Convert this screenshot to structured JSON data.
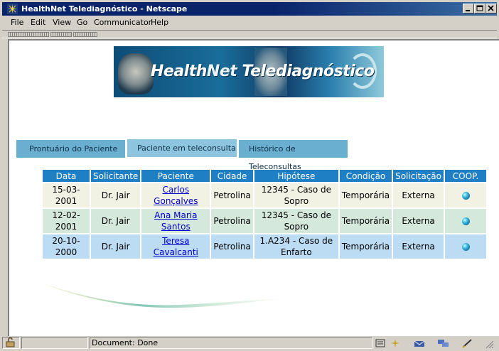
{
  "window": {
    "title": "HealthNet Telediagnóstico - Netscape",
    "controls": [
      "minimize",
      "maximize",
      "close"
    ]
  },
  "menubar": {
    "items": [
      {
        "label": "File"
      },
      {
        "label": "Edit"
      },
      {
        "label": "View"
      },
      {
        "label": "Go"
      },
      {
        "label": "Communicator"
      },
      {
        "label": "Help"
      }
    ]
  },
  "banner": {
    "brand_part1": "Health",
    "brand_part2": "Net",
    "brand_part3": " Telediagnóstico"
  },
  "tabs": [
    {
      "label": "Prontuário do Paciente",
      "active": false
    },
    {
      "label": "Paciente em teleconsulta",
      "active": true
    },
    {
      "label": "Histórico de Teleconsultas",
      "active": false
    }
  ],
  "table": {
    "headers": [
      "Data",
      "Solicitante",
      "Paciente",
      "Cidade",
      "Hipótese",
      "Condição",
      "Solicitação",
      "COOP."
    ],
    "rows": [
      {
        "data": "15-03-2001",
        "solicitante": "Dr. Jair",
        "paciente": "Carlos Gonçalves",
        "cidade": "Petrolina",
        "hipotese": "12345 - Caso de Sopro",
        "condicao": "Temporária",
        "solicitacao": "Externa",
        "coop": "ball-icon"
      },
      {
        "data": "12-02-2001",
        "solicitante": "Dr. Jair",
        "paciente": "Ana Maria Santos",
        "cidade": "Petrolina",
        "hipotese": "12345 - Caso de Sopro",
        "condicao": "Temporária",
        "solicitacao": "Externa",
        "coop": "ball-icon"
      },
      {
        "data": "20-10-2000",
        "solicitante": "Dr. Jair",
        "paciente": "Teresa Cavalcanti",
        "cidade": "Petrolina",
        "hipotese": "1.A234 - Caso de Enfarto",
        "condicao": "Temporária",
        "solicitacao": "Externa",
        "coop": "ball-icon"
      }
    ]
  },
  "statusbar": {
    "text": "Document: Done"
  },
  "colors": {
    "header_blue": "#1f7fc4",
    "tab_blue": "#6aaed0",
    "row1": "#f2f2e4",
    "row2": "#d4e8dc",
    "row3": "#bcdcf4"
  }
}
